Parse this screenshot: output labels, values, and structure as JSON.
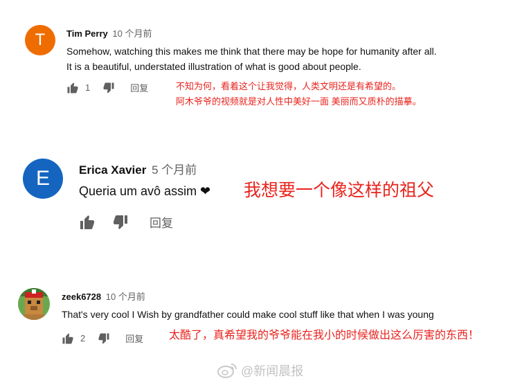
{
  "comments": [
    {
      "avatar_letter": "T",
      "avatar_color": "#ef6c00",
      "author": "Tim Perry",
      "time": "10 个月前",
      "text_line1": "Somehow, watching this makes me think that there may be hope for humanity after all.",
      "text_line2": "It is a beautiful, understated illustration of what is good about people.",
      "likes": "1",
      "reply_label": "回复",
      "translation_line1": "不知为何，看着这个让我觉得，人类文明还是有希望的。",
      "translation_line2": "阿木爷爷的视频就是对人性中美好一面 美丽而又质朴的描摹。"
    },
    {
      "avatar_letter": "E",
      "avatar_color": "#1565c0",
      "author": "Erica Xavier",
      "time": "5 个月前",
      "text": "Queria um avô assim ❤",
      "reply_label": "回复",
      "translation": "我想要一个像这样的祖父"
    },
    {
      "author": "zeek6728",
      "time": "10 个月前",
      "text": "That's very cool I Wish by grandfather could make cool stuff like that when I was young",
      "likes": "2",
      "reply_label": "回复",
      "translation": "太酷了，真希望我的爷爷能在我小的时候做出这么厉害的东西！"
    }
  ],
  "watermark": "@新闻晨报",
  "colors": {
    "translation_red": "#e8231d",
    "meta_gray": "#606060"
  },
  "icons": [
    "thumbs-up-icon",
    "thumbs-down-icon",
    "weibo-logo-icon"
  ]
}
